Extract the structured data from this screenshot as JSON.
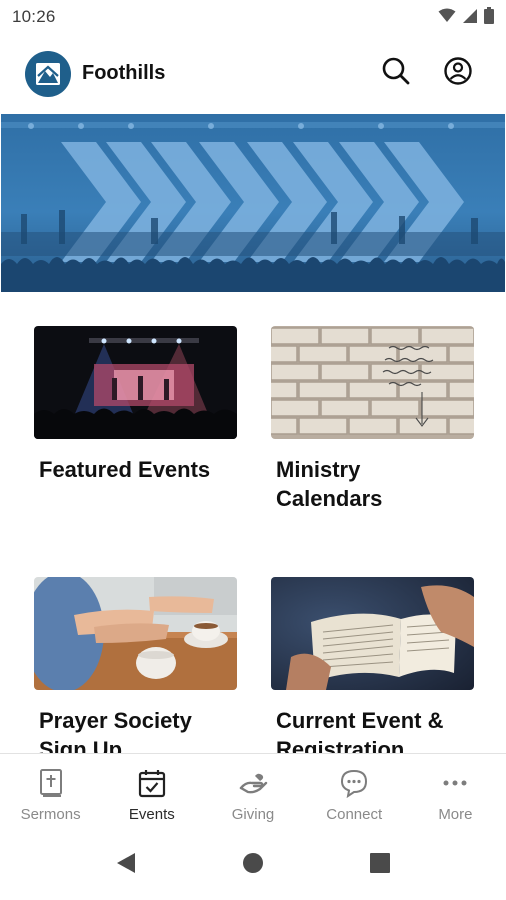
{
  "status_bar": {
    "time": "10:26",
    "icons": [
      "wifi-icon",
      "signal-icon",
      "battery-icon"
    ]
  },
  "header": {
    "title": "Foothills",
    "logo": "foothills-logo",
    "actions": [
      "search-icon",
      "account-icon"
    ]
  },
  "hero": {
    "image": "worship-stage-with-chevron-arrows-blue-overlay"
  },
  "cards": [
    {
      "label": "Featured Events",
      "image": "concert-stage-crowd-photo"
    },
    {
      "label": "Ministry Calendars",
      "image": "brick-wall-writing-photo"
    },
    {
      "label": "Prayer Society Sign Up",
      "image": "praying-hands-coffee-photo"
    },
    {
      "label": "Current Event & Registration",
      "image": "open-bible-photo"
    }
  ],
  "bottom_nav": {
    "active": "Events",
    "items": [
      {
        "label": "Sermons",
        "icon": "bible-icon"
      },
      {
        "label": "Events",
        "icon": "calendar-check-icon"
      },
      {
        "label": "Giving",
        "icon": "giving-hand-icon"
      },
      {
        "label": "Connect",
        "icon": "chat-bubble-icon"
      },
      {
        "label": "More",
        "icon": "more-dots-icon"
      }
    ]
  },
  "system_nav": [
    "back-icon",
    "home-icon",
    "recents-icon"
  ],
  "colors": {
    "brand_blue": "#1f5f8b",
    "hero_blue": "#3a7fb8",
    "text": "#111111",
    "nav_inactive": "#8a8a8a"
  }
}
